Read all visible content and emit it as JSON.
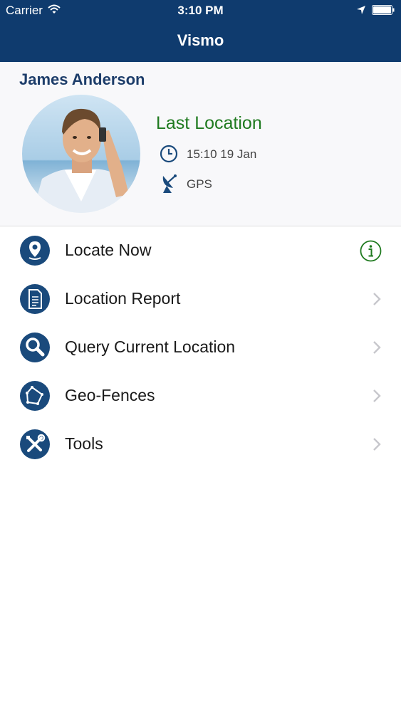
{
  "status_bar": {
    "carrier": "Carrier",
    "time": "3:10 PM"
  },
  "nav": {
    "title": "Vismo"
  },
  "profile": {
    "name": "James Anderson",
    "last_location_title": "Last Location",
    "time": "15:10 19 Jan",
    "source": "GPS"
  },
  "menu": {
    "items": [
      {
        "label": "Locate Now",
        "icon": "map-pin-icon",
        "accessory": "info-icon"
      },
      {
        "label": "Location Report",
        "icon": "document-icon",
        "accessory": "chevron-right-icon"
      },
      {
        "label": "Query Current Location",
        "icon": "magnifier-icon",
        "accessory": "chevron-right-icon"
      },
      {
        "label": "Geo-Fences",
        "icon": "polygon-icon",
        "accessory": "chevron-right-icon"
      },
      {
        "label": "Tools",
        "icon": "tools-icon",
        "accessory": "chevron-right-icon"
      }
    ]
  },
  "colors": {
    "nav_bg": "#0f3b6e",
    "name_text": "#1d3d6a",
    "last_location_green": "#1f7a1f",
    "icon_circle": "#1a4a7c",
    "chevron": "#c7c7cc"
  }
}
